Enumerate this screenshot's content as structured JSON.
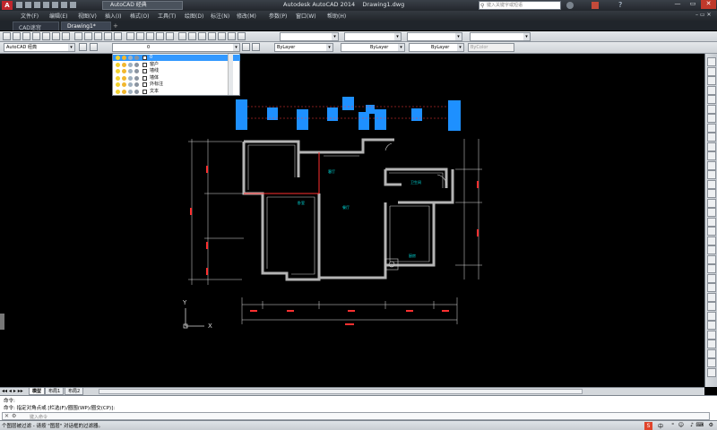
{
  "window": {
    "app_name": "Autodesk AutoCAD 2014",
    "document": "Drawing1.dwg",
    "workspace_quick": "AutoCAD 经典",
    "search_placeholder": "键入关键字或短语",
    "title_right_btns": [
      "—",
      "▭",
      "✕"
    ]
  },
  "menu": {
    "items": [
      "文件(F)",
      "编辑(E)",
      "视图(V)",
      "插入(I)",
      "格式(O)",
      "工具(T)",
      "绘图(D)",
      "标注(N)",
      "修改(M)",
      "参数(P)",
      "窗口(W)",
      "帮助(H)"
    ]
  },
  "tabs": [
    {
      "label": "CAD迷宫"
    },
    {
      "label": "Drawing1*"
    }
  ],
  "toolbar2": {
    "workspace": "AutoCAD 经典",
    "layer_current": "0",
    "color": "ByLayer",
    "linetype": "ByLayer",
    "lineweight": "ByLayer",
    "plotstyle": "ByColor"
  },
  "layer_dropdown": {
    "layers": [
      {
        "name": "0",
        "selected": true
      },
      {
        "name": "窗户",
        "selected": false
      },
      {
        "name": "墙线",
        "selected": false
      },
      {
        "name": "墙体",
        "selected": false
      },
      {
        "name": "外标注",
        "selected": false
      },
      {
        "name": "文本",
        "selected": false
      }
    ]
  },
  "layout_tabs": [
    {
      "label": "模型",
      "active": true
    },
    {
      "label": "布局1",
      "active": false
    },
    {
      "label": "布局2",
      "active": false
    }
  ],
  "command": {
    "history_1": "命令:",
    "history_2": "命令: 指定对角点或 [栏选(F)/圈围(WP)/圈交(CP)]:",
    "prompt_placeholder": "键入命令"
  },
  "status": {
    "text": "个图层被过滤 - 请按 \"图层\" 对话框的过滤器。"
  },
  "drawing": {
    "room_labels": [
      "客厅",
      "卧室",
      "厨房",
      "卫生间",
      "餐厅"
    ],
    "ucs": {
      "x": "X",
      "y": "Y"
    },
    "colors": {
      "walls": "#b4b4b4",
      "dims": "#e0e0e0",
      "accent": "#ff3030",
      "text": "#00e0e0",
      "blocks": "#1e90ff"
    }
  }
}
